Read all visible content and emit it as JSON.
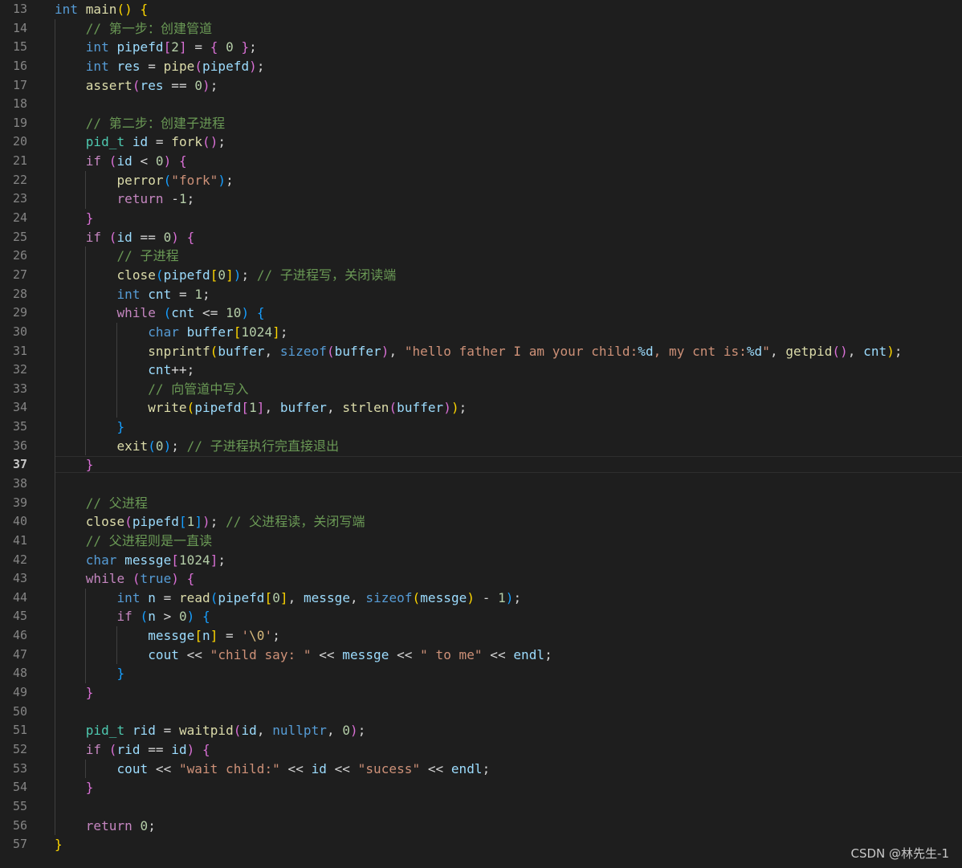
{
  "editor": {
    "first_line_number": 13,
    "active_line": 37,
    "lines": [
      [
        [
          "kw",
          "int"
        ],
        [
          "pn",
          " "
        ],
        [
          "fn",
          "main"
        ],
        [
          "b1",
          "()"
        ],
        [
          "pn",
          " "
        ],
        [
          "b1",
          "{"
        ]
      ],
      [
        [
          "pn",
          "    "
        ],
        [
          "cm",
          "// 第一步：创建管道"
        ]
      ],
      [
        [
          "pn",
          "    "
        ],
        [
          "kw",
          "int"
        ],
        [
          "pn",
          " "
        ],
        [
          "var",
          "pipefd"
        ],
        [
          "b2",
          "["
        ],
        [
          "num",
          "2"
        ],
        [
          "b2",
          "]"
        ],
        [
          "pn",
          " = "
        ],
        [
          "b2",
          "{"
        ],
        [
          "pn",
          " "
        ],
        [
          "num",
          "0"
        ],
        [
          "pn",
          " "
        ],
        [
          "b2",
          "}"
        ],
        [
          "pn",
          ";"
        ]
      ],
      [
        [
          "pn",
          "    "
        ],
        [
          "kw",
          "int"
        ],
        [
          "pn",
          " "
        ],
        [
          "var",
          "res"
        ],
        [
          "pn",
          " = "
        ],
        [
          "fn",
          "pipe"
        ],
        [
          "b2",
          "("
        ],
        [
          "var",
          "pipefd"
        ],
        [
          "b2",
          ")"
        ],
        [
          "pn",
          ";"
        ]
      ],
      [
        [
          "pn",
          "    "
        ],
        [
          "fn",
          "assert"
        ],
        [
          "b2",
          "("
        ],
        [
          "var",
          "res"
        ],
        [
          "pn",
          " == "
        ],
        [
          "num",
          "0"
        ],
        [
          "b2",
          ")"
        ],
        [
          "pn",
          ";"
        ]
      ],
      [],
      [
        [
          "pn",
          "    "
        ],
        [
          "cm",
          "// 第二步：创建子进程"
        ]
      ],
      [
        [
          "pn",
          "    "
        ],
        [
          "ty",
          "pid_t"
        ],
        [
          "pn",
          " "
        ],
        [
          "var",
          "id"
        ],
        [
          "pn",
          " = "
        ],
        [
          "fn",
          "fork"
        ],
        [
          "b2",
          "()"
        ],
        [
          "pn",
          ";"
        ]
      ],
      [
        [
          "pn",
          "    "
        ],
        [
          "ctl",
          "if"
        ],
        [
          "pn",
          " "
        ],
        [
          "b2",
          "("
        ],
        [
          "var",
          "id"
        ],
        [
          "pn",
          " < "
        ],
        [
          "num",
          "0"
        ],
        [
          "b2",
          ")"
        ],
        [
          "pn",
          " "
        ],
        [
          "b2",
          "{"
        ]
      ],
      [
        [
          "pn",
          "        "
        ],
        [
          "fn",
          "perror"
        ],
        [
          "b3",
          "("
        ],
        [
          "str",
          "\"fork\""
        ],
        [
          "b3",
          ")"
        ],
        [
          "pn",
          ";"
        ]
      ],
      [
        [
          "pn",
          "        "
        ],
        [
          "ctl",
          "return"
        ],
        [
          "pn",
          " -"
        ],
        [
          "num",
          "1"
        ],
        [
          "pn",
          ";"
        ]
      ],
      [
        [
          "pn",
          "    "
        ],
        [
          "b2",
          "}"
        ]
      ],
      [
        [
          "pn",
          "    "
        ],
        [
          "ctl",
          "if"
        ],
        [
          "pn",
          " "
        ],
        [
          "b2",
          "("
        ],
        [
          "var",
          "id"
        ],
        [
          "pn",
          " == "
        ],
        [
          "num",
          "0"
        ],
        [
          "b2",
          ")"
        ],
        [
          "pn",
          " "
        ],
        [
          "b2",
          "{"
        ]
      ],
      [
        [
          "pn",
          "        "
        ],
        [
          "cm",
          "// 子进程"
        ]
      ],
      [
        [
          "pn",
          "        "
        ],
        [
          "fn",
          "close"
        ],
        [
          "b3",
          "("
        ],
        [
          "var",
          "pipefd"
        ],
        [
          "b1",
          "["
        ],
        [
          "num",
          "0"
        ],
        [
          "b1",
          "]"
        ],
        [
          "b3",
          ")"
        ],
        [
          "pn",
          "; "
        ],
        [
          "cm",
          "// 子进程写，关闭读端"
        ]
      ],
      [
        [
          "pn",
          "        "
        ],
        [
          "kw",
          "int"
        ],
        [
          "pn",
          " "
        ],
        [
          "var",
          "cnt"
        ],
        [
          "pn",
          " = "
        ],
        [
          "num",
          "1"
        ],
        [
          "pn",
          ";"
        ]
      ],
      [
        [
          "pn",
          "        "
        ],
        [
          "ctl",
          "while"
        ],
        [
          "pn",
          " "
        ],
        [
          "b3",
          "("
        ],
        [
          "var",
          "cnt"
        ],
        [
          "pn",
          " <= "
        ],
        [
          "num",
          "10"
        ],
        [
          "b3",
          ")"
        ],
        [
          "pn",
          " "
        ],
        [
          "b3",
          "{"
        ]
      ],
      [
        [
          "pn",
          "            "
        ],
        [
          "kw",
          "char"
        ],
        [
          "pn",
          " "
        ],
        [
          "var",
          "buffer"
        ],
        [
          "b1",
          "["
        ],
        [
          "num",
          "1024"
        ],
        [
          "b1",
          "]"
        ],
        [
          "pn",
          ";"
        ]
      ],
      [
        [
          "pn",
          "            "
        ],
        [
          "fn",
          "snprintf"
        ],
        [
          "b1",
          "("
        ],
        [
          "var",
          "buffer"
        ],
        [
          "pn",
          ", "
        ],
        [
          "kw",
          "sizeof"
        ],
        [
          "b2",
          "("
        ],
        [
          "var",
          "buffer"
        ],
        [
          "b2",
          ")"
        ],
        [
          "pn",
          ", "
        ],
        [
          "str",
          "\"hello father I am your child:"
        ],
        [
          "fmt",
          "%d"
        ],
        [
          "str",
          ", my cnt is:"
        ],
        [
          "fmt",
          "%d"
        ],
        [
          "str",
          "\""
        ],
        [
          "pn",
          ", "
        ],
        [
          "fn",
          "getpid"
        ],
        [
          "b2",
          "()"
        ],
        [
          "pn",
          ", "
        ],
        [
          "var",
          "cnt"
        ],
        [
          "b1",
          ")"
        ],
        [
          "pn",
          ";"
        ]
      ],
      [
        [
          "pn",
          "            "
        ],
        [
          "var",
          "cnt"
        ],
        [
          "pn",
          "++;"
        ]
      ],
      [
        [
          "pn",
          "            "
        ],
        [
          "cm",
          "// 向管道中写入"
        ]
      ],
      [
        [
          "pn",
          "            "
        ],
        [
          "fn",
          "write"
        ],
        [
          "b1",
          "("
        ],
        [
          "var",
          "pipefd"
        ],
        [
          "b2",
          "["
        ],
        [
          "num",
          "1"
        ],
        [
          "b2",
          "]"
        ],
        [
          "pn",
          ", "
        ],
        [
          "var",
          "buffer"
        ],
        [
          "pn",
          ", "
        ],
        [
          "fn",
          "strlen"
        ],
        [
          "b2",
          "("
        ],
        [
          "var",
          "buffer"
        ],
        [
          "b2",
          ")"
        ],
        [
          "b1",
          ")"
        ],
        [
          "pn",
          ";"
        ]
      ],
      [
        [
          "pn",
          "        "
        ],
        [
          "b3",
          "}"
        ]
      ],
      [
        [
          "pn",
          "        "
        ],
        [
          "fn",
          "exit"
        ],
        [
          "b3",
          "("
        ],
        [
          "num",
          "0"
        ],
        [
          "b3",
          ")"
        ],
        [
          "pn",
          "; "
        ],
        [
          "cm",
          "// 子进程执行完直接退出"
        ]
      ],
      [
        [
          "pn",
          "    "
        ],
        [
          "b2",
          "}"
        ]
      ],
      [],
      [
        [
          "pn",
          "    "
        ],
        [
          "cm",
          "// 父进程"
        ]
      ],
      [
        [
          "pn",
          "    "
        ],
        [
          "fn",
          "close"
        ],
        [
          "b2",
          "("
        ],
        [
          "var",
          "pipefd"
        ],
        [
          "b3",
          "["
        ],
        [
          "num",
          "1"
        ],
        [
          "b3",
          "]"
        ],
        [
          "b2",
          ")"
        ],
        [
          "pn",
          "; "
        ],
        [
          "cm",
          "// 父进程读，关闭写端"
        ]
      ],
      [
        [
          "pn",
          "    "
        ],
        [
          "cm",
          "// 父进程则是一直读"
        ]
      ],
      [
        [
          "pn",
          "    "
        ],
        [
          "kw",
          "char"
        ],
        [
          "pn",
          " "
        ],
        [
          "var",
          "messge"
        ],
        [
          "b2",
          "["
        ],
        [
          "num",
          "1024"
        ],
        [
          "b2",
          "]"
        ],
        [
          "pn",
          ";"
        ]
      ],
      [
        [
          "pn",
          "    "
        ],
        [
          "ctl",
          "while"
        ],
        [
          "pn",
          " "
        ],
        [
          "b2",
          "("
        ],
        [
          "kw",
          "true"
        ],
        [
          "b2",
          ")"
        ],
        [
          "pn",
          " "
        ],
        [
          "b2",
          "{"
        ]
      ],
      [
        [
          "pn",
          "        "
        ],
        [
          "kw",
          "int"
        ],
        [
          "pn",
          " "
        ],
        [
          "var",
          "n"
        ],
        [
          "pn",
          " = "
        ],
        [
          "fn",
          "read"
        ],
        [
          "b3",
          "("
        ],
        [
          "var",
          "pipefd"
        ],
        [
          "b1",
          "["
        ],
        [
          "num",
          "0"
        ],
        [
          "b1",
          "]"
        ],
        [
          "pn",
          ", "
        ],
        [
          "var",
          "messge"
        ],
        [
          "pn",
          ", "
        ],
        [
          "kw",
          "sizeof"
        ],
        [
          "b1",
          "("
        ],
        [
          "var",
          "messge"
        ],
        [
          "b1",
          ")"
        ],
        [
          "pn",
          " - "
        ],
        [
          "num",
          "1"
        ],
        [
          "b3",
          ")"
        ],
        [
          "pn",
          ";"
        ]
      ],
      [
        [
          "pn",
          "        "
        ],
        [
          "ctl",
          "if"
        ],
        [
          "pn",
          " "
        ],
        [
          "b3",
          "("
        ],
        [
          "var",
          "n"
        ],
        [
          "pn",
          " > "
        ],
        [
          "num",
          "0"
        ],
        [
          "b3",
          ")"
        ],
        [
          "pn",
          " "
        ],
        [
          "b3",
          "{"
        ]
      ],
      [
        [
          "pn",
          "            "
        ],
        [
          "var",
          "messge"
        ],
        [
          "b1",
          "["
        ],
        [
          "var",
          "n"
        ],
        [
          "b1",
          "]"
        ],
        [
          "pn",
          " = "
        ],
        [
          "str",
          "'"
        ],
        [
          "esc",
          "\\0"
        ],
        [
          "str",
          "'"
        ],
        [
          "pn",
          ";"
        ]
      ],
      [
        [
          "pn",
          "            "
        ],
        [
          "var",
          "cout"
        ],
        [
          "pn",
          " << "
        ],
        [
          "str",
          "\"child say: \""
        ],
        [
          "pn",
          " << "
        ],
        [
          "var",
          "messge"
        ],
        [
          "pn",
          " << "
        ],
        [
          "str",
          "\" to me\""
        ],
        [
          "pn",
          " << "
        ],
        [
          "var",
          "endl"
        ],
        [
          "pn",
          ";"
        ]
      ],
      [
        [
          "pn",
          "        "
        ],
        [
          "b3",
          "}"
        ]
      ],
      [
        [
          "pn",
          "    "
        ],
        [
          "b2",
          "}"
        ]
      ],
      [],
      [
        [
          "pn",
          "    "
        ],
        [
          "ty",
          "pid_t"
        ],
        [
          "pn",
          " "
        ],
        [
          "var",
          "rid"
        ],
        [
          "pn",
          " = "
        ],
        [
          "fn",
          "waitpid"
        ],
        [
          "b2",
          "("
        ],
        [
          "var",
          "id"
        ],
        [
          "pn",
          ", "
        ],
        [
          "kw",
          "nullptr"
        ],
        [
          "pn",
          ", "
        ],
        [
          "num",
          "0"
        ],
        [
          "b2",
          ")"
        ],
        [
          "pn",
          ";"
        ]
      ],
      [
        [
          "pn",
          "    "
        ],
        [
          "ctl",
          "if"
        ],
        [
          "pn",
          " "
        ],
        [
          "b2",
          "("
        ],
        [
          "var",
          "rid"
        ],
        [
          "pn",
          " == "
        ],
        [
          "var",
          "id"
        ],
        [
          "b2",
          ")"
        ],
        [
          "pn",
          " "
        ],
        [
          "b2",
          "{"
        ]
      ],
      [
        [
          "pn",
          "        "
        ],
        [
          "var",
          "cout"
        ],
        [
          "pn",
          " << "
        ],
        [
          "str",
          "\"wait child:\""
        ],
        [
          "pn",
          " << "
        ],
        [
          "var",
          "id"
        ],
        [
          "pn",
          " << "
        ],
        [
          "str",
          "\"sucess\""
        ],
        [
          "pn",
          " << "
        ],
        [
          "var",
          "endl"
        ],
        [
          "pn",
          ";"
        ]
      ],
      [
        [
          "pn",
          "    "
        ],
        [
          "b2",
          "}"
        ]
      ],
      [],
      [
        [
          "pn",
          "    "
        ],
        [
          "ctl",
          "return"
        ],
        [
          "pn",
          " "
        ],
        [
          "num",
          "0"
        ],
        [
          "pn",
          ";"
        ]
      ],
      [
        [
          "b1",
          "}"
        ]
      ]
    ]
  },
  "watermark": "CSDN @林先生-1"
}
